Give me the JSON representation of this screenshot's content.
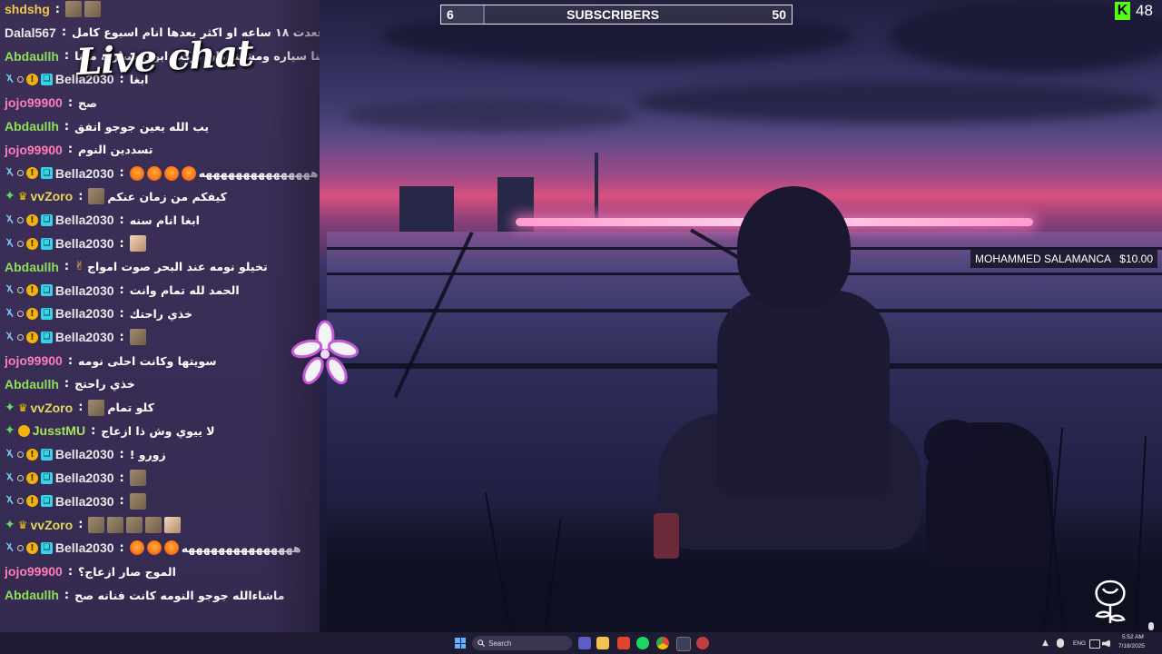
{
  "overlay": {
    "chat_title": "Live chat",
    "subscribers": {
      "current": "6",
      "label": "SUBSCRIBERS",
      "goal": "50",
      "progress_fraction": 0.12
    },
    "kick_viewers": "48",
    "donation": {
      "name": "MOHAMMED SALAMANCA",
      "amount": "$10.00"
    }
  },
  "colors": {
    "kick_green": "#53fc18",
    "user_gold": "#f2c94c",
    "user_yellowgreen": "#e6d85c",
    "user_pink": "#ff7db8",
    "user_green": "#8ee05a",
    "user_lightgreen": "#a6e35a",
    "user_white": "#e8e8e8",
    "user_cyan": "#7fd8ff"
  },
  "chat": {
    "messages": [
      {
        "user": "shdshg",
        "color": "#f2c94c",
        "badges": [],
        "text": "",
        "emotes": [
          "emote",
          "emote"
        ]
      },
      {
        "user": "Dalal567",
        "color": "#e8e8e8",
        "badges": [],
        "text": "انا اذا قعدت ١٨ ساعه او اكثر بعدها انام اسبوع كامل",
        "emotes": []
      },
      {
        "user": "Abdaullh",
        "color": "#8ee05a",
        "badges": [],
        "text": "مرا كنا ركبنا سياره ومشينا كان بركب ابوي سيارته معنا",
        "emotes": []
      },
      {
        "user": "Bella2030",
        "color": "#e8e8e8",
        "badges": [
          "sword",
          "dot",
          "coin",
          "bits"
        ],
        "text": "ابغا",
        "emotes": []
      },
      {
        "user": "jojo99900",
        "color": "#ff7db8",
        "badges": [],
        "text": "صح",
        "emotes": []
      },
      {
        "user": "Abdaullh",
        "color": "#8ee05a",
        "badges": [],
        "text": "يب الله يعين جوجو اتفق",
        "emotes": []
      },
      {
        "user": "jojo99900",
        "color": "#ff7db8",
        "badges": [],
        "text": "تسددين النوم",
        "emotes": []
      },
      {
        "user": "Bella2030",
        "color": "#e8e8e8",
        "badges": [
          "sword",
          "dot",
          "coin",
          "bits"
        ],
        "text": "هههههههههههههههه",
        "emotes": [
          "face",
          "face",
          "face",
          "face"
        ]
      },
      {
        "user": "vvZoro",
        "color": "#e6d85c",
        "badges": [
          "diamond",
          "crown"
        ],
        "text": "كيفكم من زمان عنكم",
        "emotes": [
          "emote"
        ]
      },
      {
        "user": "Bella2030",
        "color": "#e8e8e8",
        "badges": [
          "sword",
          "dot",
          "coin",
          "bits"
        ],
        "text": "ابغا انام سنه",
        "emotes": []
      },
      {
        "user": "Bella2030",
        "color": "#e8e8e8",
        "badges": [
          "sword",
          "dot",
          "coin",
          "bits"
        ],
        "text": "",
        "emotes": [
          "cat"
        ]
      },
      {
        "user": "Abdaullh",
        "color": "#8ee05a",
        "badges": [],
        "text": "تخيلو نومه عند البحر صوت امواج",
        "emotes": [
          "hand"
        ]
      },
      {
        "user": "Bella2030",
        "color": "#e8e8e8",
        "badges": [
          "sword",
          "dot",
          "coin",
          "bits"
        ],
        "text": "الحمد لله تمام وانت",
        "emotes": []
      },
      {
        "user": "Bella2030",
        "color": "#e8e8e8",
        "badges": [
          "sword",
          "dot",
          "coin",
          "bits"
        ],
        "text": "خذي راحتك",
        "emotes": []
      },
      {
        "user": "Bella2030",
        "color": "#e8e8e8",
        "badges": [
          "sword",
          "dot",
          "coin",
          "bits"
        ],
        "text": "",
        "emotes": [
          "emote"
        ]
      },
      {
        "user": "jojo99900",
        "color": "#ff7db8",
        "badges": [],
        "text": "سويتها وكانت احلى نومه",
        "emotes": []
      },
      {
        "user": "Abdaullh",
        "color": "#8ee05a",
        "badges": [],
        "text": "خذي راحتج",
        "emotes": []
      },
      {
        "user": "vvZoro",
        "color": "#e6d85c",
        "badges": [
          "diamond",
          "crown"
        ],
        "text": "كلو تمام",
        "emotes": [
          "emote"
        ]
      },
      {
        "user": "JusstMU",
        "color": "#a6e35a",
        "badges": [
          "plus",
          "coin_small"
        ],
        "text": "لا ييوي وش ذا ازعاج",
        "emotes": []
      },
      {
        "user": "Bella2030",
        "color": "#e8e8e8",
        "badges": [
          "sword",
          "dot",
          "coin",
          "bits"
        ],
        "text": "زورو !",
        "emotes": []
      },
      {
        "user": "Bella2030",
        "color": "#e8e8e8",
        "badges": [
          "sword",
          "dot",
          "coin",
          "bits"
        ],
        "text": "",
        "emotes": [
          "emote"
        ]
      },
      {
        "user": "Bella2030",
        "color": "#e8e8e8",
        "badges": [
          "sword",
          "dot",
          "coin",
          "bits"
        ],
        "text": "",
        "emotes": [
          "emote"
        ]
      },
      {
        "user": "vvZoro",
        "color": "#e6d85c",
        "badges": [
          "diamond",
          "crown"
        ],
        "text": "",
        "emotes": [
          "emote",
          "emote",
          "emote",
          "emote",
          "cat"
        ]
      },
      {
        "user": "Bella2030",
        "color": "#e8e8e8",
        "badges": [
          "sword",
          "dot",
          "coin",
          "bits"
        ],
        "text": "هههههههههههههههه",
        "emotes": [
          "face",
          "face",
          "face"
        ]
      },
      {
        "user": "jojo99900",
        "color": "#ff7db8",
        "badges": [],
        "text": "الموج صار ازعاج؟",
        "emotes": []
      },
      {
        "user": "Abdaullh",
        "color": "#8ee05a",
        "badges": [],
        "text": "ماشاءالله جوجو النومه كانت فنانه صح",
        "emotes": []
      }
    ]
  },
  "taskbar": {
    "search_placeholder": "Search",
    "language": "ENG",
    "time": "5:52 AM",
    "date": "7/18/2025"
  }
}
